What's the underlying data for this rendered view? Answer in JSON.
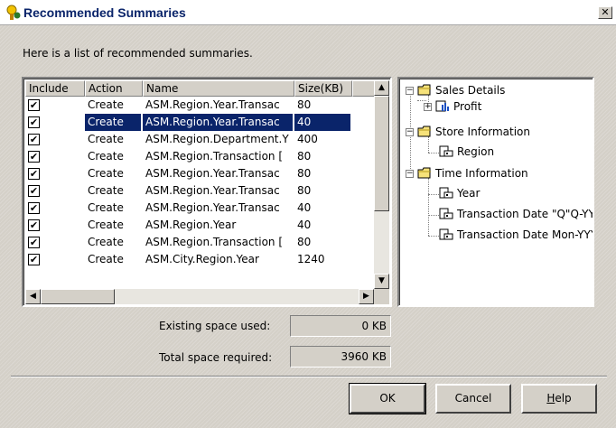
{
  "window": {
    "title": "Recommended Summaries",
    "close_glyph": "✕"
  },
  "intro_text": "Here is a list of recommended summaries.",
  "table": {
    "columns": [
      "Include",
      "Action",
      "Name",
      "Size(KB)"
    ],
    "rows": [
      {
        "include": true,
        "action": "Create",
        "name": "ASM.Region.Year.Transac",
        "size": "80",
        "selected": false
      },
      {
        "include": true,
        "action": "Create",
        "name": "ASM.Region.Year.Transac",
        "size": "40",
        "selected": true
      },
      {
        "include": true,
        "action": "Create",
        "name": "ASM.Region.Department.Y",
        "size": "400",
        "selected": false
      },
      {
        "include": true,
        "action": "Create",
        "name": "ASM.Region.Transaction [",
        "size": "80",
        "selected": false
      },
      {
        "include": true,
        "action": "Create",
        "name": "ASM.Region.Year.Transac",
        "size": "80",
        "selected": false
      },
      {
        "include": true,
        "action": "Create",
        "name": "ASM.Region.Year.Transac",
        "size": "80",
        "selected": false
      },
      {
        "include": true,
        "action": "Create",
        "name": "ASM.Region.Year.Transac",
        "size": "40",
        "selected": false
      },
      {
        "include": true,
        "action": "Create",
        "name": "ASM.Region.Year",
        "size": "40",
        "selected": false
      },
      {
        "include": true,
        "action": "Create",
        "name": "ASM.Region.Transaction [",
        "size": "80",
        "selected": false
      },
      {
        "include": true,
        "action": "Create",
        "name": "ASM.City.Region.Year",
        "size": "1240",
        "selected": false
      }
    ]
  },
  "tree": {
    "nodes": [
      {
        "label": "Sales Details",
        "icon": "folder-icon",
        "expander": "−"
      },
      {
        "label": "Profit",
        "icon": "measure-icon",
        "expander": "+"
      },
      {
        "label": "Store Information",
        "icon": "folder-icon",
        "expander": "−"
      },
      {
        "label": "Region",
        "icon": "dimension-icon"
      },
      {
        "label": "Time Information",
        "icon": "folder-icon",
        "expander": "−"
      },
      {
        "label": "Year",
        "icon": "dimension-icon"
      },
      {
        "label": "Transaction Date \"Q\"Q-YY",
        "icon": "dimension-icon"
      },
      {
        "label": "Transaction Date Mon-YYY",
        "icon": "dimension-icon"
      }
    ]
  },
  "space": {
    "existing_label": "Existing space used:",
    "existing_value": "0 KB",
    "total_label": "Total space required:",
    "total_value": "3960 KB"
  },
  "buttons": {
    "ok": "OK",
    "cancel": "Cancel",
    "help_prefix": "H",
    "help_rest": "elp"
  },
  "check_glyph": "✔",
  "scroll_glyphs": {
    "up": "▲",
    "down": "▼",
    "left": "◀",
    "right": "▶"
  }
}
